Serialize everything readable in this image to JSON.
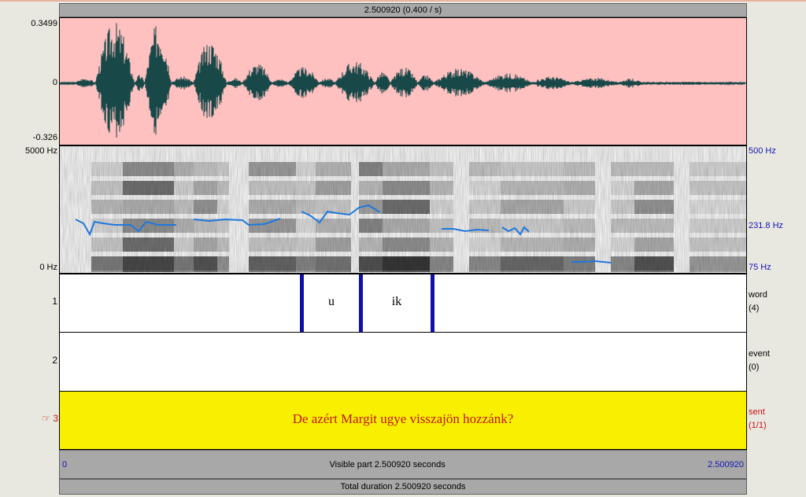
{
  "header": {
    "selection_label": "2.500920 (0.400 / s)"
  },
  "waveform": {
    "y_max": "0.3499",
    "y_zero": "0",
    "y_min": "-0.326",
    "bg_color": "#ffc0c0",
    "wave_color": "#184848"
  },
  "spectrogram": {
    "freq_max": "5000 Hz",
    "freq_min": "0 Hz",
    "pitch_max": "500 Hz",
    "pitch_mid": "231.8 Hz",
    "pitch_min": "75 Hz",
    "pitch_color": "#1e78dc"
  },
  "tiers": [
    {
      "number": "1",
      "name": "word",
      "count": "(4)",
      "intervals": [
        "u",
        "ik"
      ]
    },
    {
      "number": "2",
      "name": "event",
      "count": "(0)"
    },
    {
      "number": "3",
      "pointer": "☞",
      "name": "sent",
      "count": "(1/1)",
      "text": "De azért Margit ugye visszajön hozzánk?",
      "bg_color": "#f8f000"
    }
  ],
  "footer": {
    "start_time": "0",
    "visible_label": "Visible part 2.500920 seconds",
    "end_time": "2.500920",
    "total_label": "Total duration 2.500920 seconds"
  }
}
